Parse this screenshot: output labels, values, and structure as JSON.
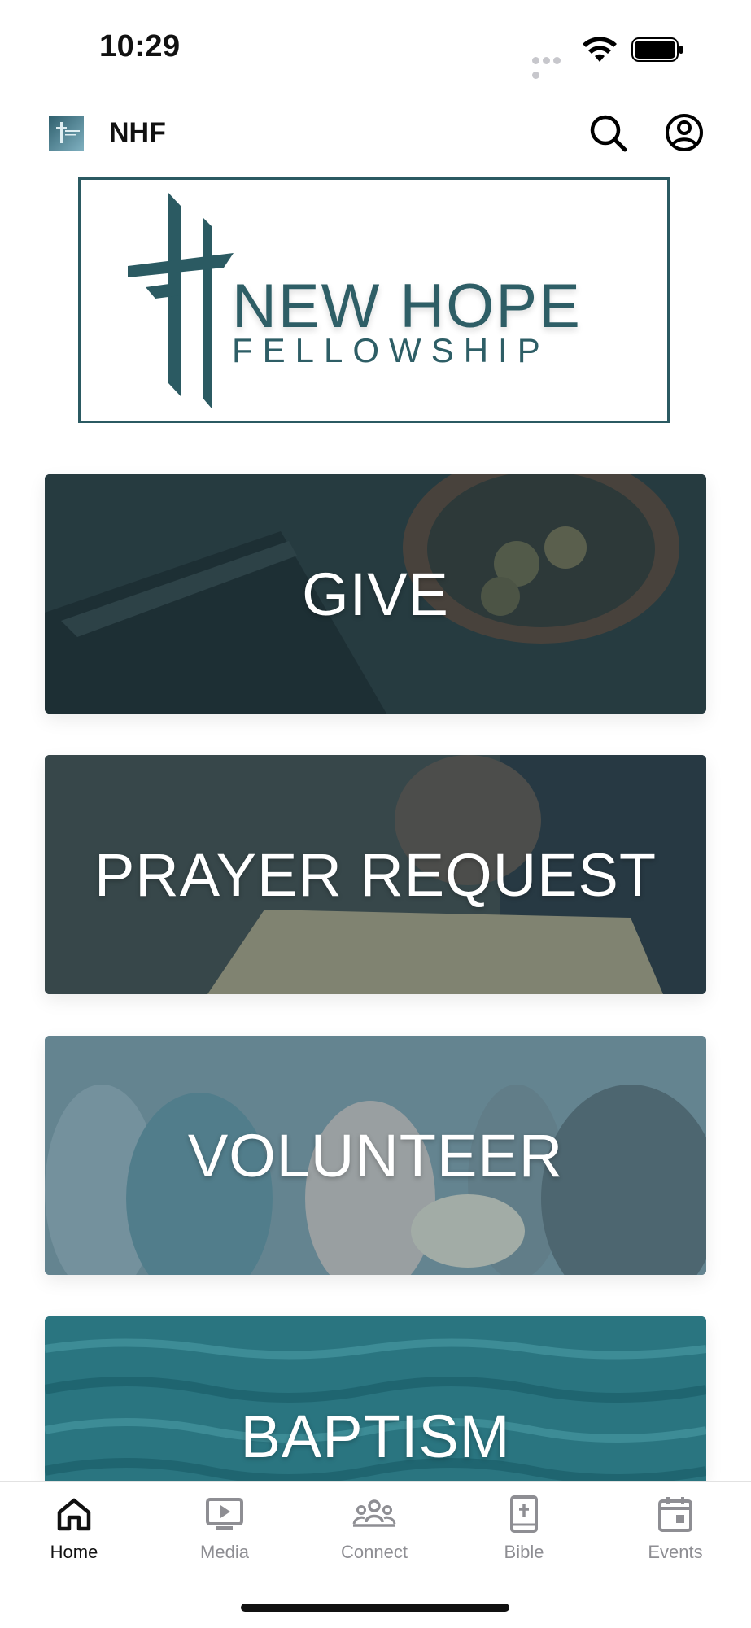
{
  "status_bar": {
    "time": "10:29"
  },
  "header": {
    "app_name": "NHF",
    "search_icon": "search-icon",
    "account_icon": "user-circle-icon"
  },
  "banner": {
    "title": "NEW HOPE",
    "subtitle": "FELLOWSHIP"
  },
  "cards": [
    {
      "label": "GIVE"
    },
    {
      "label": "PRAYER REQUEST"
    },
    {
      "label": "VOLUNTEER"
    },
    {
      "label": "BAPTISM"
    }
  ],
  "tabbar": {
    "items": [
      {
        "label": "Home",
        "icon": "home-icon",
        "active": true
      },
      {
        "label": "Media",
        "icon": "media-icon",
        "active": false
      },
      {
        "label": "Connect",
        "icon": "people-icon",
        "active": false
      },
      {
        "label": "Bible",
        "icon": "bible-icon",
        "active": false
      },
      {
        "label": "Events",
        "icon": "calendar-icon",
        "active": false
      }
    ]
  },
  "colors": {
    "brand_teal": "#2e5e66",
    "tab_inactive": "#8e8e93",
    "tab_active": "#111111"
  }
}
